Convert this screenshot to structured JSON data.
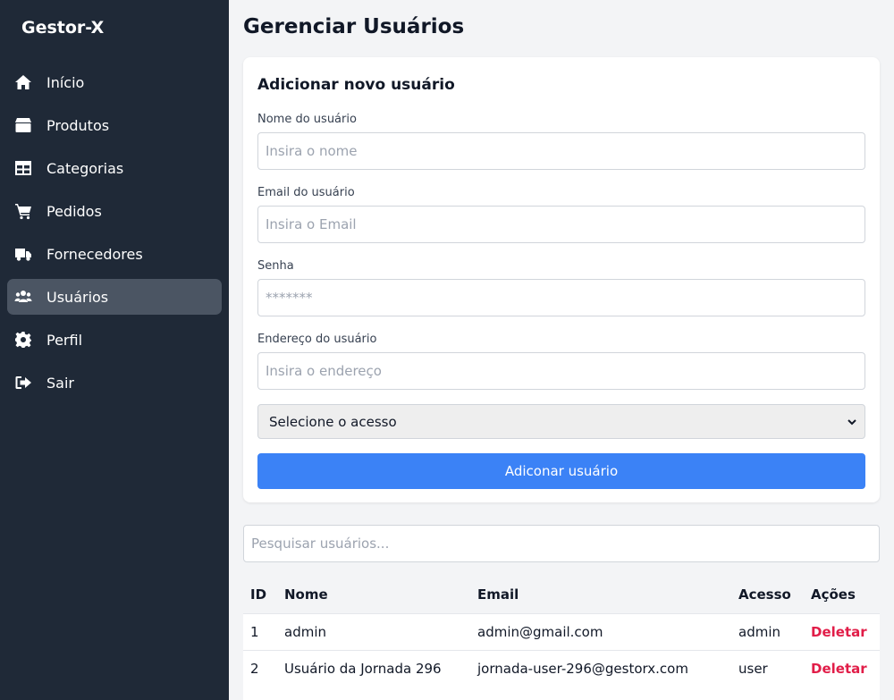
{
  "brand": "Gestor-X",
  "nav": [
    {
      "label": "Início",
      "icon": "home-icon"
    },
    {
      "label": "Produtos",
      "icon": "box-icon"
    },
    {
      "label": "Categorias",
      "icon": "table-icon"
    },
    {
      "label": "Pedidos",
      "icon": "cart-icon"
    },
    {
      "label": "Fornecedores",
      "icon": "truck-icon"
    },
    {
      "label": "Usuários",
      "icon": "users-icon",
      "active": true
    },
    {
      "label": "Perfil",
      "icon": "gear-icon"
    },
    {
      "label": "Sair",
      "icon": "sign-out-icon"
    }
  ],
  "page_title": "Gerenciar Usuários",
  "form": {
    "title": "Adicionar novo usuário",
    "name_label": "Nome do usuário",
    "name_placeholder": "Insira o nome",
    "email_label": "Email do usuário",
    "email_placeholder": "Insira o Email",
    "password_label": "Senha",
    "password_placeholder": "*******",
    "address_label": "Endereço do usuário",
    "address_placeholder": "Insira o endereço",
    "access_select": "Selecione o acesso",
    "submit_label": "Adiconar usuário"
  },
  "search": {
    "placeholder": "Pesquisar usuários..."
  },
  "table": {
    "headers": {
      "id": "ID",
      "name": "Nome",
      "email": "Email",
      "access": "Acesso",
      "actions": "Ações"
    },
    "rows": [
      {
        "id": "1",
        "name": "admin",
        "email": "admin@gmail.com",
        "access": "admin",
        "action": "Deletar"
      },
      {
        "id": "2",
        "name": "Usuário da Jornada 296",
        "email": "jornada-user-296@gestorx.com",
        "access": "user",
        "action": "Deletar"
      }
    ]
  },
  "colors": {
    "sidebar": "#1f2937",
    "active_item": "#4b5563",
    "primary": "#3b82f6",
    "danger": "#e11d48"
  }
}
